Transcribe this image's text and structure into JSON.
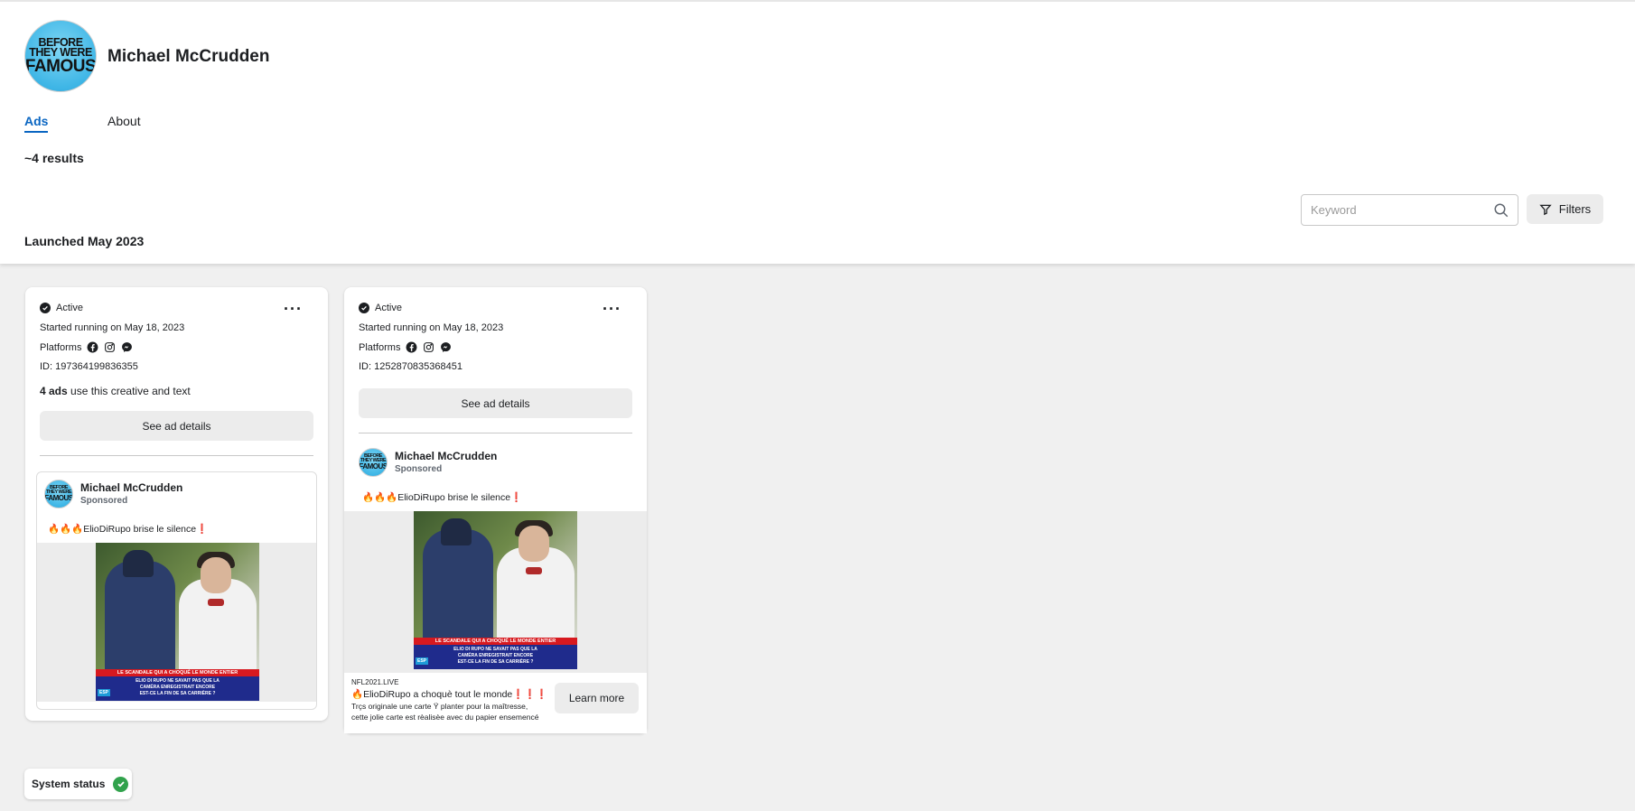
{
  "page": {
    "name": "Michael McCrudden",
    "logo_text_small": "BEFORE THEY WERE",
    "logo_text_big": "FAMOUS"
  },
  "tabs": {
    "ads": "Ads",
    "about": "About"
  },
  "results_count": "~4 results",
  "search": {
    "placeholder": "Keyword"
  },
  "filters_label": "Filters",
  "section_title": "Launched May 2023",
  "icons": [
    "check-icon",
    "more-icon",
    "facebook-icon",
    "instagram-icon",
    "messenger-icon",
    "search-icon",
    "filter-icon"
  ],
  "cards": [
    {
      "status": "Active",
      "started": "Started running on May 18, 2023",
      "platforms_label": "Platforms",
      "id": "ID: 197364199836355",
      "ads_count": "4 ads",
      "ads_count_suffix": "use this creative and text",
      "details_button": "See ad details",
      "advertiser": "Michael McCrudden",
      "sponsored": "Sponsored",
      "ad_text": "🔥🔥🔥ElioDiRupo brise le silence❗",
      "image_banner_red": "LE SCANDALE QUI A CHOQUÉ LE MONDE ENTIER",
      "image_banner_blue": [
        "ELIO DI RUPO NE SAVAIT PAS QUE LA",
        "CAMÉRA ENREGISTRAIT ENCORE",
        "EST-CE LA FIN DE SA CARRIÈRE ?"
      ],
      "image_logo": "ESP"
    },
    {
      "status": "Active",
      "started": "Started running on May 18, 2023",
      "platforms_label": "Platforms",
      "id": "ID: 1252870835368451",
      "details_button": "See ad details",
      "advertiser": "Michael McCrudden",
      "sponsored": "Sponsored",
      "ad_text": "🔥🔥🔥ElioDiRupo brise le silence❗",
      "image_banner_red": "LE SCANDALE QUI A CHOQUÉ LE MONDE ENTIER",
      "image_banner_blue": [
        "ELIO DI RUPO NE SAVAIT PAS QUE LA",
        "CAMÉRA ENREGISTRAIT ENCORE",
        "EST-CE LA FIN DE SA CARRIÈRE ?"
      ],
      "image_logo": "ESP",
      "link_domain": "NFL2021.LIVE",
      "link_headline": "🔥ElioDiRupo a choquè tout le monde❗❗❗",
      "link_desc_1": "Trçs originale une carte Ÿ planter pour la maîtresse,",
      "link_desc_2": "cette jolie carte est rèalisèe avec du papier ensemencé",
      "cta": "Learn more"
    }
  ],
  "system_status": "System status",
  "colors": {
    "accent": "#0a66c2",
    "status_ok": "#31a24c",
    "background": "#f0f0f0"
  }
}
